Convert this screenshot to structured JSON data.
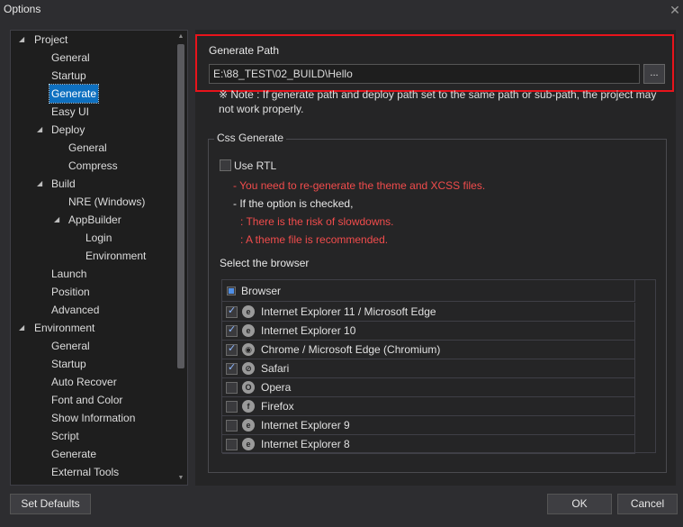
{
  "window": {
    "title": "Options",
    "close_glyph": "✕"
  },
  "tree": {
    "items": [
      {
        "label": "Project",
        "indent": 0,
        "expanded": true
      },
      {
        "label": "General",
        "indent": 1
      },
      {
        "label": "Startup",
        "indent": 1
      },
      {
        "label": "Generate",
        "indent": 1,
        "selected": true
      },
      {
        "label": "Easy UI",
        "indent": 1
      },
      {
        "label": "Deploy",
        "indent": 1,
        "expanded": true
      },
      {
        "label": "General",
        "indent": 2
      },
      {
        "label": "Compress",
        "indent": 2
      },
      {
        "label": "Build",
        "indent": 1,
        "expanded": true
      },
      {
        "label": "NRE (Windows)",
        "indent": 2
      },
      {
        "label": "AppBuilder",
        "indent": 2,
        "expanded": true
      },
      {
        "label": "Login",
        "indent": 3
      },
      {
        "label": "Environment",
        "indent": 3
      },
      {
        "label": "Launch",
        "indent": 1
      },
      {
        "label": "Position",
        "indent": 1
      },
      {
        "label": "Advanced",
        "indent": 1
      },
      {
        "label": "Environment",
        "indent": 0,
        "expanded": true
      },
      {
        "label": "General",
        "indent": 1
      },
      {
        "label": "Startup",
        "indent": 1
      },
      {
        "label": "Auto Recover",
        "indent": 1
      },
      {
        "label": "Font and Color",
        "indent": 1
      },
      {
        "label": "Show Information",
        "indent": 1
      },
      {
        "label": "Script",
        "indent": 1
      },
      {
        "label": "Generate",
        "indent": 1
      },
      {
        "label": "External Tools",
        "indent": 1
      }
    ]
  },
  "generate_path": {
    "label": "Generate Path",
    "value": "E:\\88_TEST\\02_BUILD\\Hello",
    "browse_label": "...",
    "note": "※ Note : If generate path and deploy path set to the same path or sub-path, the project may not work properly."
  },
  "css_generate": {
    "title": "Css Generate",
    "use_rtl_label": "Use RTL",
    "use_rtl_checked": false,
    "messages": [
      {
        "text": "- You need to re-generate the theme and XCSS files.",
        "color": "red"
      },
      {
        "text": "- If the option is checked,",
        "color": "white"
      },
      {
        "text": ": There is the risk of slowdowns.",
        "color": "red"
      },
      {
        "text": ": A theme file is recommended.",
        "color": "red"
      }
    ],
    "select_browser_label": "Select the browser",
    "browser_header": "Browser",
    "browsers": [
      {
        "name": "Internet Explorer 11 / Microsoft Edge",
        "checked": true,
        "icon": "ie-icon",
        "glyph": "e"
      },
      {
        "name": "Internet Explorer 10",
        "checked": true,
        "icon": "ie-icon",
        "glyph": "e"
      },
      {
        "name": "Chrome / Microsoft Edge (Chromium)",
        "checked": true,
        "icon": "chrome-icon",
        "glyph": "◉"
      },
      {
        "name": "Safari",
        "checked": true,
        "icon": "safari-icon",
        "glyph": "⊘"
      },
      {
        "name": "Opera",
        "checked": false,
        "icon": "opera-icon",
        "glyph": "O"
      },
      {
        "name": "Firefox",
        "checked": false,
        "icon": "firefox-icon",
        "glyph": "f"
      },
      {
        "name": "Internet Explorer 9",
        "checked": false,
        "icon": "ie-icon",
        "glyph": "e"
      },
      {
        "name": "Internet Explorer 8",
        "checked": false,
        "icon": "ie-icon",
        "glyph": "e"
      }
    ]
  },
  "buttons": {
    "set_defaults": "Set Defaults",
    "ok": "OK",
    "cancel": "Cancel"
  },
  "colors": {
    "highlight_border": "#e8131b",
    "selection": "#0e70c0",
    "warning_text": "#f14c4c"
  }
}
